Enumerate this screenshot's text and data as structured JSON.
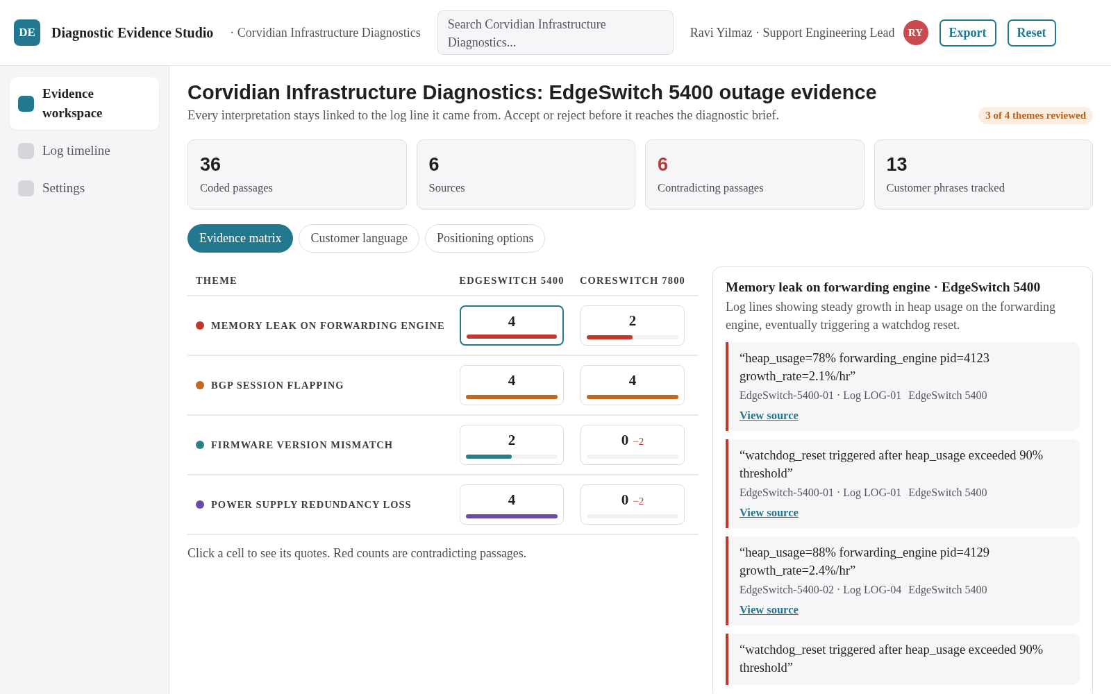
{
  "app": {
    "logo": "DE",
    "title": "Diagnostic Evidence Studio",
    "context": "· Corvidian Infrastructure Diagnostics"
  },
  "search": {
    "placeholder": "Search Corvidian Infrastructure Diagnostics..."
  },
  "user": {
    "name": "Ravi Yilmaz · Support Engineering Lead",
    "initials": "RY"
  },
  "actions": [
    "Export",
    "Reset"
  ],
  "sidebar": {
    "items": [
      {
        "label": "Evidence workspace",
        "selected": true
      },
      {
        "label": "Log timeline",
        "selected": false
      },
      {
        "label": "Settings",
        "selected": false
      }
    ]
  },
  "page": {
    "title": "Corvidian Infrastructure Diagnostics: EdgeSwitch 5400 outage evidence",
    "subtitle": "Every interpretation stays linked to the log line it came from. Accept or reject before it reaches the diagnostic brief.",
    "badge": "3 of 4 themes reviewed"
  },
  "stats": [
    {
      "value": "36",
      "label": "Coded passages",
      "alert": false
    },
    {
      "value": "6",
      "label": "Sources",
      "alert": false
    },
    {
      "value": "6",
      "label": "Contradicting passages",
      "alert": true
    },
    {
      "value": "13",
      "label": "Customer phrases tracked",
      "alert": false
    }
  ],
  "tabs": [
    {
      "label": "Evidence matrix",
      "selected": true
    },
    {
      "label": "Customer language",
      "selected": false
    },
    {
      "label": "Positioning options",
      "selected": false
    }
  ],
  "matrix": {
    "columns": [
      "THEME",
      "EDGESWITCH 5400",
      "CORESWITCH 7800"
    ],
    "rows": [
      {
        "cells": [
          {
            "kind": "theme",
            "text": "MEMORY LEAK ON FORWARDING ENGINE",
            "color": "#c0392b"
          },
          {
            "count": "4",
            "level": 1,
            "selected": true
          },
          {
            "count": "2",
            "level": 0.5,
            "selected": false
          }
        ]
      },
      {
        "cells": [
          {
            "kind": "theme",
            "text": "BGP SESSION FLAPPING",
            "color": "#c0661f"
          },
          {
            "count": "4",
            "level": 1,
            "selected": false
          },
          {
            "count": "4",
            "level": 1,
            "selected": false
          }
        ]
      },
      {
        "cells": [
          {
            "kind": "theme",
            "text": "FIRMWARE VERSION MISMATCH",
            "color": "#2a7f86"
          },
          {
            "count": "2",
            "level": 0.5,
            "selected": false
          },
          {
            "count": "0",
            "contradictions": "−2",
            "selected": false
          }
        ]
      },
      {
        "cells": [
          {
            "kind": "theme",
            "text": "POWER SUPPLY REDUNDANCY LOSS",
            "color": "#6c4aa8"
          },
          {
            "count": "4",
            "level": 1,
            "selected": false
          },
          {
            "count": "0",
            "contradictions": "−2",
            "selected": false
          }
        ]
      }
    ],
    "note": "Click a cell to see its quotes. Red counts are contradicting passages."
  },
  "detail": {
    "title": "Memory leak on forwarding engine · EdgeSwitch 5400",
    "description": "Log lines showing steady growth in heap usage on the forwarding engine, eventually triggering a watchdog reset.",
    "quotes": [
      {
        "text": "“heap_usage=78% forwarding_engine pid=4123 growth_rate=2.1%/hr”",
        "source": "EdgeSwitch-5400-01 · Log LOG-01",
        "product": "EdgeSwitch 5400",
        "link": "View source"
      },
      {
        "text": "“watchdog_reset triggered after heap_usage exceeded 90% threshold”",
        "source": "EdgeSwitch-5400-01 · Log LOG-01",
        "product": "EdgeSwitch 5400",
        "link": "View source"
      },
      {
        "text": "“heap_usage=88% forwarding_engine pid=4129 growth_rate=2.4%/hr”",
        "source": "EdgeSwitch-5400-02 · Log LOG-04",
        "product": "EdgeSwitch 5400",
        "link": "View source"
      },
      {
        "text": "“watchdog_reset triggered after heap_usage exceeded 90% threshold”"
      }
    ]
  }
}
